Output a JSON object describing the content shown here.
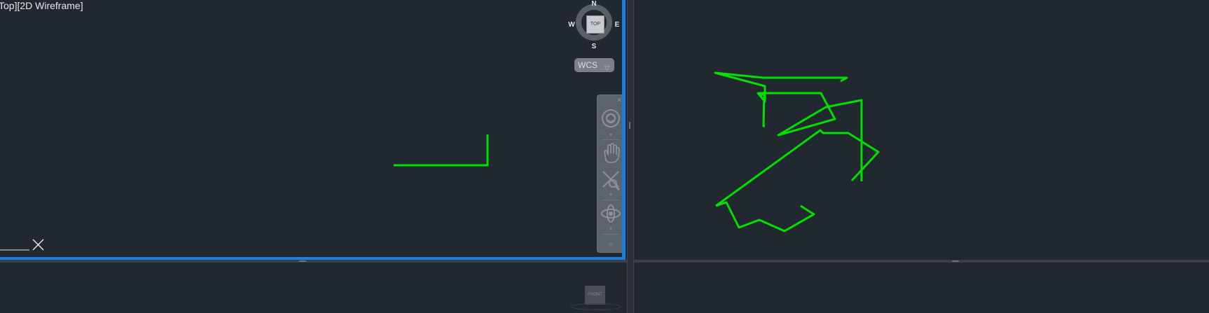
{
  "viewports": {
    "top_left": {
      "label": "Top][2D Wireframe]"
    }
  },
  "viewcube": {
    "face": "TOP",
    "north": "N",
    "south": "S",
    "east": "E",
    "west": "W",
    "coordinate_system": "WCS"
  },
  "mini_viewcube": {
    "face": "FRONT"
  },
  "navbar": {
    "tools": [
      "steeringwheels-icon",
      "pan-icon",
      "zoom-extents-icon",
      "orbit-icon"
    ]
  },
  "colors": {
    "background": "#212830",
    "geometry": "#00e000",
    "active_viewport_border": "#1a7ee6"
  }
}
